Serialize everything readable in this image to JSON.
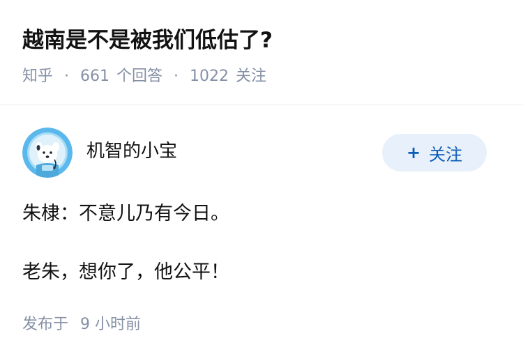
{
  "question": {
    "title": "越南是不是被我们低估了?",
    "source": "知乎",
    "separator": "·",
    "answers_count": "661",
    "answers_label": "个回答",
    "followers_count": "1022",
    "followers_label": "关注"
  },
  "answer": {
    "author": {
      "name": "机智的小宝",
      "avatar_icon": "astronaut-dog-avatar-icon"
    },
    "follow_button": {
      "plus": "+",
      "label": "关注"
    },
    "content": [
      "朱棣：不意儿乃有今日。",
      "老朱，想你了，他公平！"
    ],
    "posted_label": "发布于",
    "posted_time": "9 小时前"
  },
  "colors": {
    "title": "#121212",
    "meta": "#8590a6",
    "follow_bg": "#e8f1fb",
    "follow_text": "#0b5cb8",
    "avatar_bg": "#5bb8ec"
  }
}
